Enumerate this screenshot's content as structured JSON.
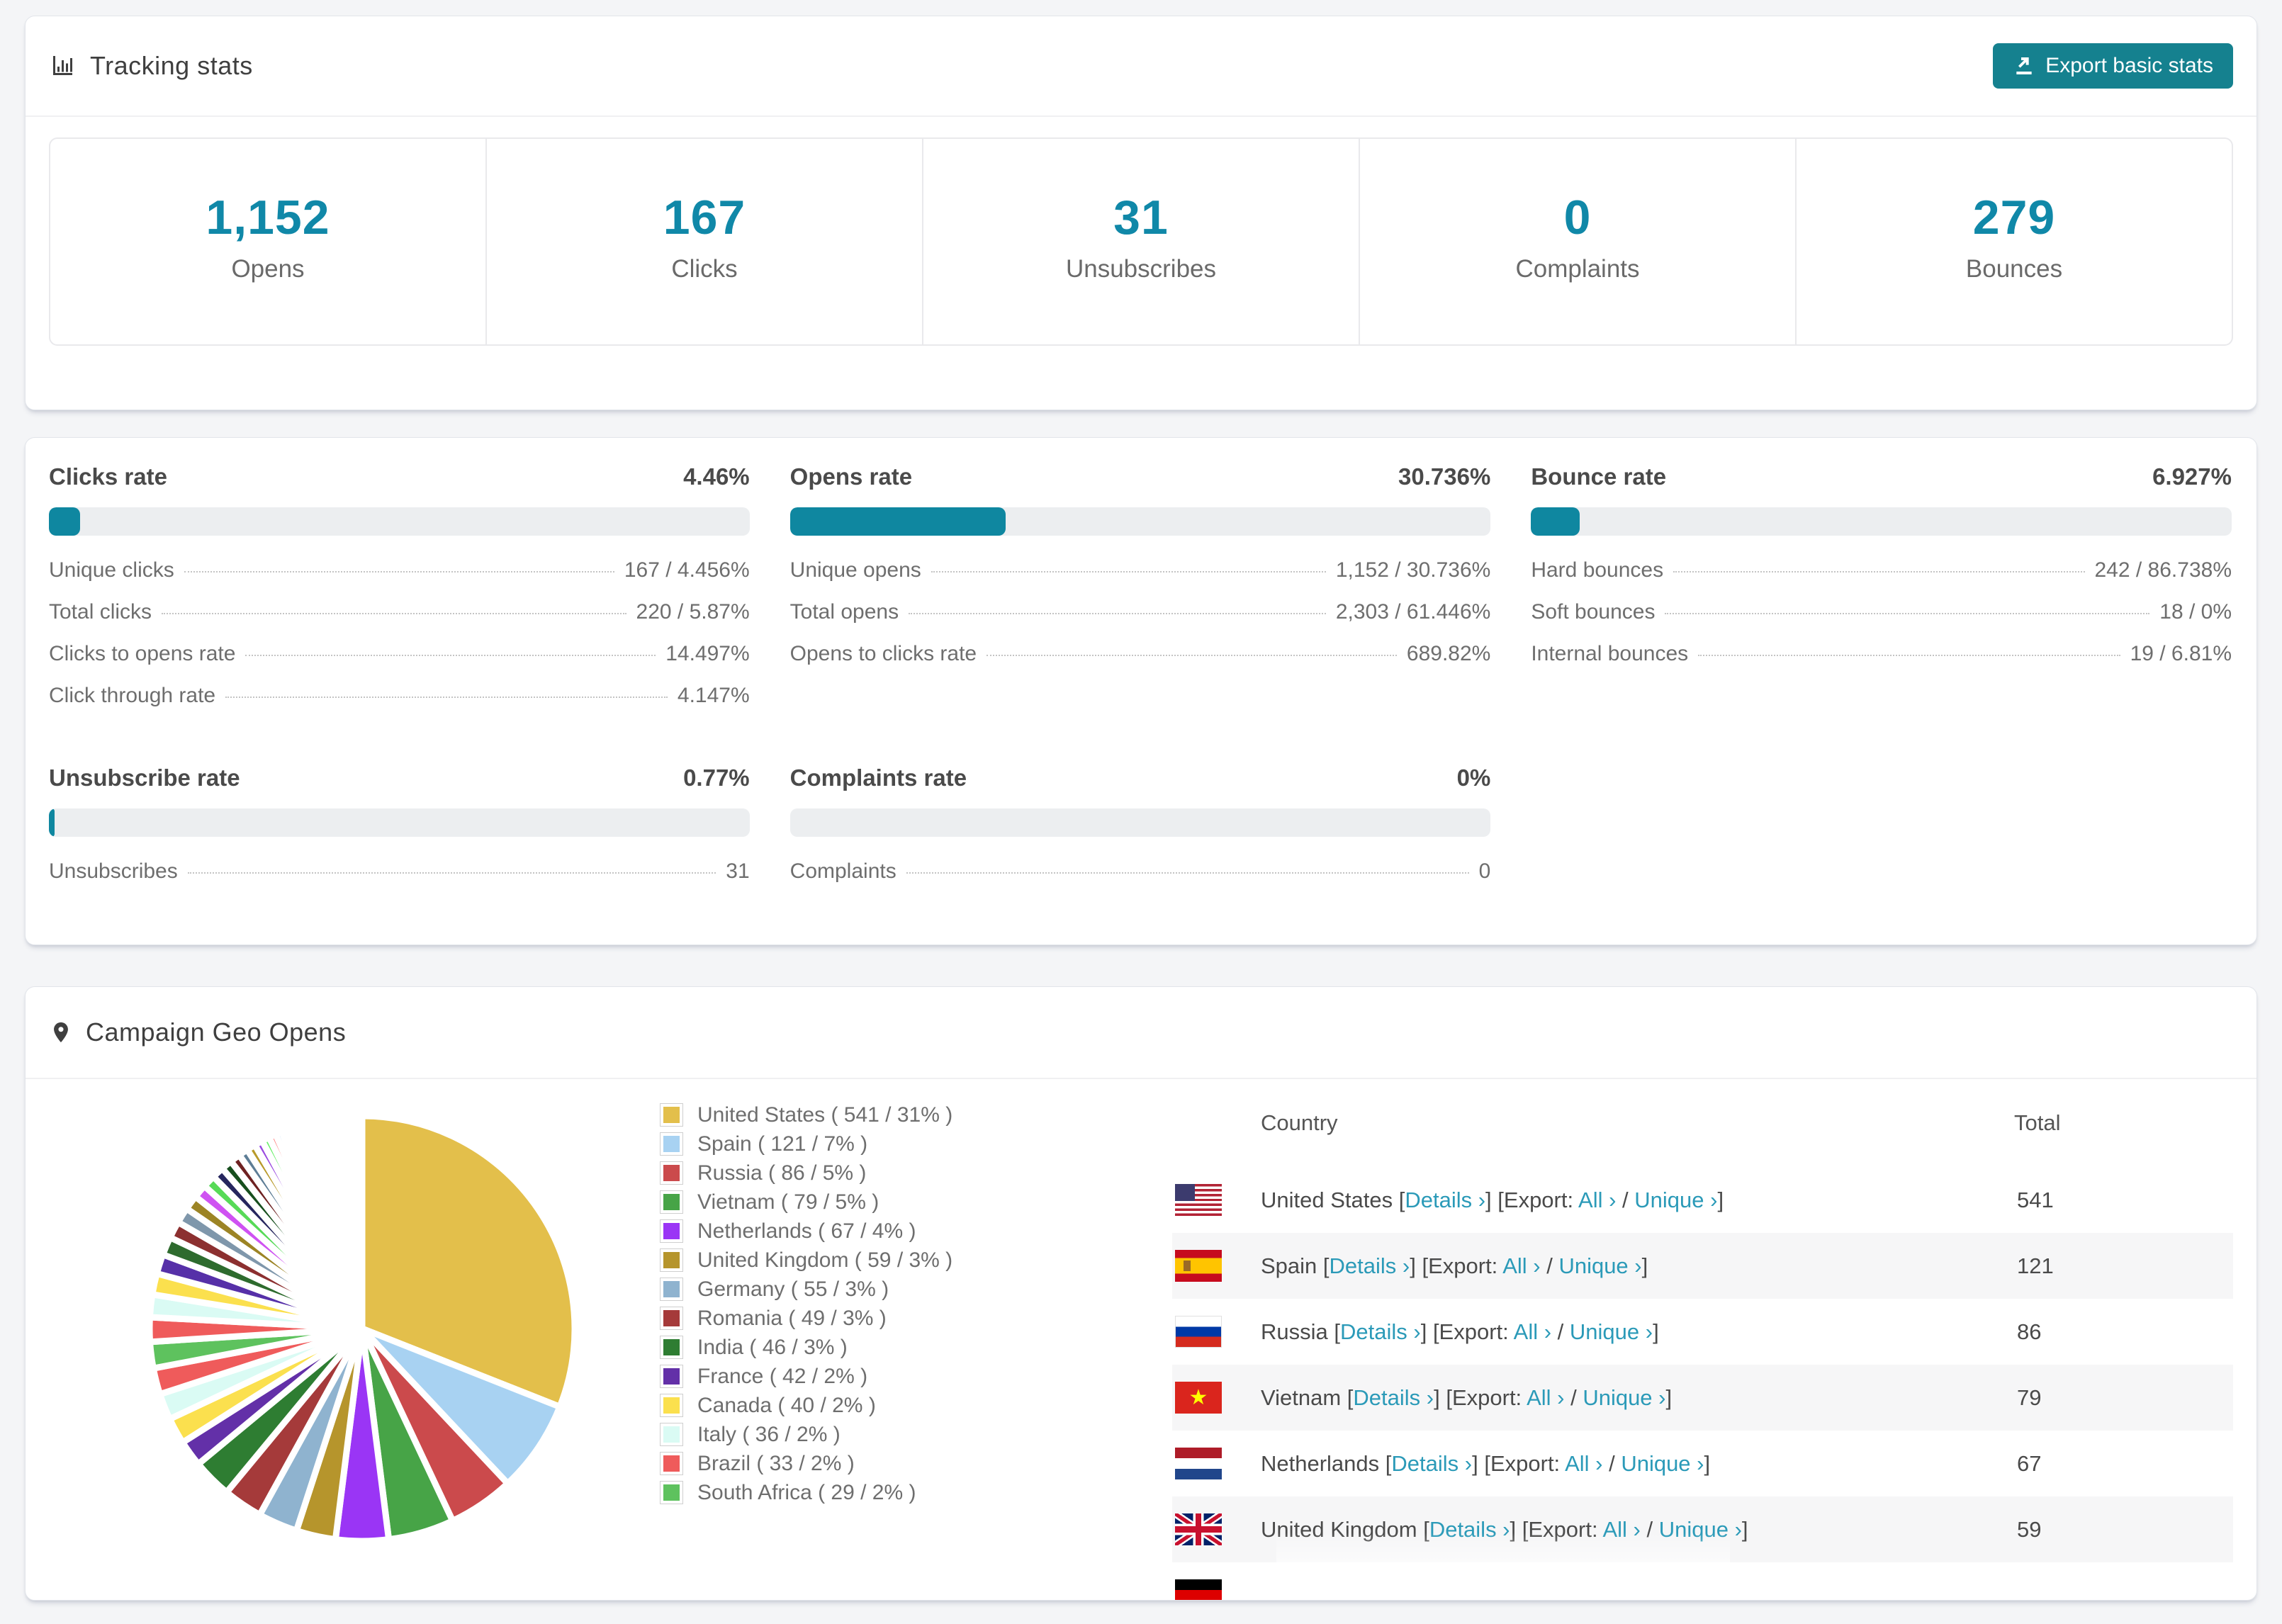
{
  "page": {
    "background": "#f4f5f7",
    "accent_teal": "#0f87a0",
    "number_teal": "#1088a8",
    "button_teal": "#15818f",
    "link_color": "#2b9ab8"
  },
  "icons": {
    "header": "bar-chart-icon",
    "export": "export-icon",
    "geo": "map-pin-icon"
  },
  "tracking": {
    "title": "Tracking stats",
    "export_button": "Export basic stats",
    "stats": [
      {
        "value": "1,152",
        "label": "Opens"
      },
      {
        "value": "167",
        "label": "Clicks"
      },
      {
        "value": "31",
        "label": "Unsubscribes"
      },
      {
        "value": "0",
        "label": "Complaints"
      },
      {
        "value": "279",
        "label": "Bounces"
      }
    ]
  },
  "rates": [
    {
      "title": "Clicks rate",
      "value": "4.46%",
      "percent": 4.46,
      "rows": [
        {
          "label": "Unique clicks",
          "value": "167 / 4.456%"
        },
        {
          "label": "Total clicks",
          "value": "220 / 5.87%"
        },
        {
          "label": "Clicks to opens rate",
          "value": "14.497%"
        },
        {
          "label": "Click through rate",
          "value": "4.147%"
        }
      ]
    },
    {
      "title": "Opens rate",
      "value": "30.736%",
      "percent": 30.736,
      "rows": [
        {
          "label": "Unique opens",
          "value": "1,152 / 30.736%"
        },
        {
          "label": "Total opens",
          "value": "2,303 / 61.446%"
        },
        {
          "label": "Opens to clicks rate",
          "value": "689.82%"
        }
      ]
    },
    {
      "title": "Bounce rate",
      "value": "6.927%",
      "percent": 6.927,
      "rows": [
        {
          "label": "Hard bounces",
          "value": "242 / 86.738%"
        },
        {
          "label": "Soft bounces",
          "value": "18 / 0%"
        },
        {
          "label": "Internal bounces",
          "value": "19 / 6.81%"
        }
      ]
    },
    {
      "title": "Unsubscribe rate",
      "value": "0.77%",
      "percent": 0.77,
      "rows": [
        {
          "label": "Unsubscribes",
          "value": "31"
        }
      ]
    },
    {
      "title": "Complaints rate",
      "value": "0%",
      "percent": 0,
      "rows": [
        {
          "label": "Complaints",
          "value": "0"
        }
      ]
    }
  ],
  "geo": {
    "title": "Campaign Geo Opens",
    "table": {
      "country_header": "Country",
      "total_header": "Total",
      "bracket_open": "[",
      "bracket_close": "]",
      "details_label": "Details ›",
      "export_prefix": "[Export:",
      "all_label": "All ›",
      "separator": "/",
      "unique_label": "Unique ›",
      "rows": [
        {
          "country": "United States",
          "flag": "us",
          "total": "541"
        },
        {
          "country": "Spain",
          "flag": "es",
          "total": "121"
        },
        {
          "country": "Russia",
          "flag": "ru",
          "total": "86"
        },
        {
          "country": "Vietnam",
          "flag": "vn",
          "total": "79"
        },
        {
          "country": "Netherlands",
          "flag": "nl",
          "total": "67"
        },
        {
          "country": "United Kingdom",
          "flag": "uk",
          "total": "59"
        },
        {
          "country": "",
          "flag": "de",
          "total": "",
          "partial": true
        }
      ]
    }
  },
  "chart_data": {
    "type": "pie",
    "title": "Campaign Geo Opens",
    "legend_position": "right",
    "labels": [
      "United States",
      "Spain",
      "Russia",
      "Vietnam",
      "Netherlands",
      "United Kingdom",
      "Germany",
      "Romania",
      "India",
      "France",
      "Canada",
      "Italy",
      "Brazil",
      "South Africa"
    ],
    "values": [
      541,
      121,
      86,
      79,
      67,
      59,
      55,
      49,
      46,
      42,
      40,
      36,
      33,
      29
    ],
    "percents": [
      31,
      7,
      5,
      5,
      4,
      3,
      3,
      3,
      3,
      2,
      2,
      2,
      2,
      2
    ],
    "colors": [
      "#e3bf4b",
      "#a8d2f2",
      "#cb4a4c",
      "#47a447",
      "#9a35f5",
      "#b6952c",
      "#8fb3cf",
      "#a53a3a",
      "#2e7d32",
      "#6330a8",
      "#fbe04e",
      "#dafbf4",
      "#ef5b5b",
      "#5ec25e"
    ],
    "start_angle_deg": -90,
    "direction": "clockwise",
    "tail_percents": [
      1.85,
      1.72,
      1.6,
      1.49,
      1.39,
      1.29,
      1.2,
      1.12,
      1.04,
      0.97,
      0.9,
      0.84,
      0.78,
      0.72,
      0.67,
      0.63,
      0.58,
      0.54,
      0.5,
      0.47,
      0.44,
      0.41,
      0.38,
      0.35,
      0.33,
      0.31,
      0.28,
      0.26,
      0.25,
      0.23,
      0.21,
      0.2,
      0.18,
      0.17,
      0.16,
      0.15,
      0.14,
      0.13,
      0.12,
      0.11,
      0.1,
      0.1,
      0.09,
      0.08,
      0.08
    ],
    "tail_colors_cycle": [
      "#ef5b5b",
      "#dafbf4",
      "#fbe04e",
      "#5630a8",
      "#2e6b2e",
      "#8c3030",
      "#7f97ab",
      "#9c8425",
      "#cf52f2",
      "#57da57",
      "#26265e",
      "#174f1e",
      "#6e2222",
      "#5d7d96",
      "#b89a2a",
      "#9a4ae0",
      "#66ef66",
      "#ff7b7b",
      "#a9d2f2"
    ]
  }
}
